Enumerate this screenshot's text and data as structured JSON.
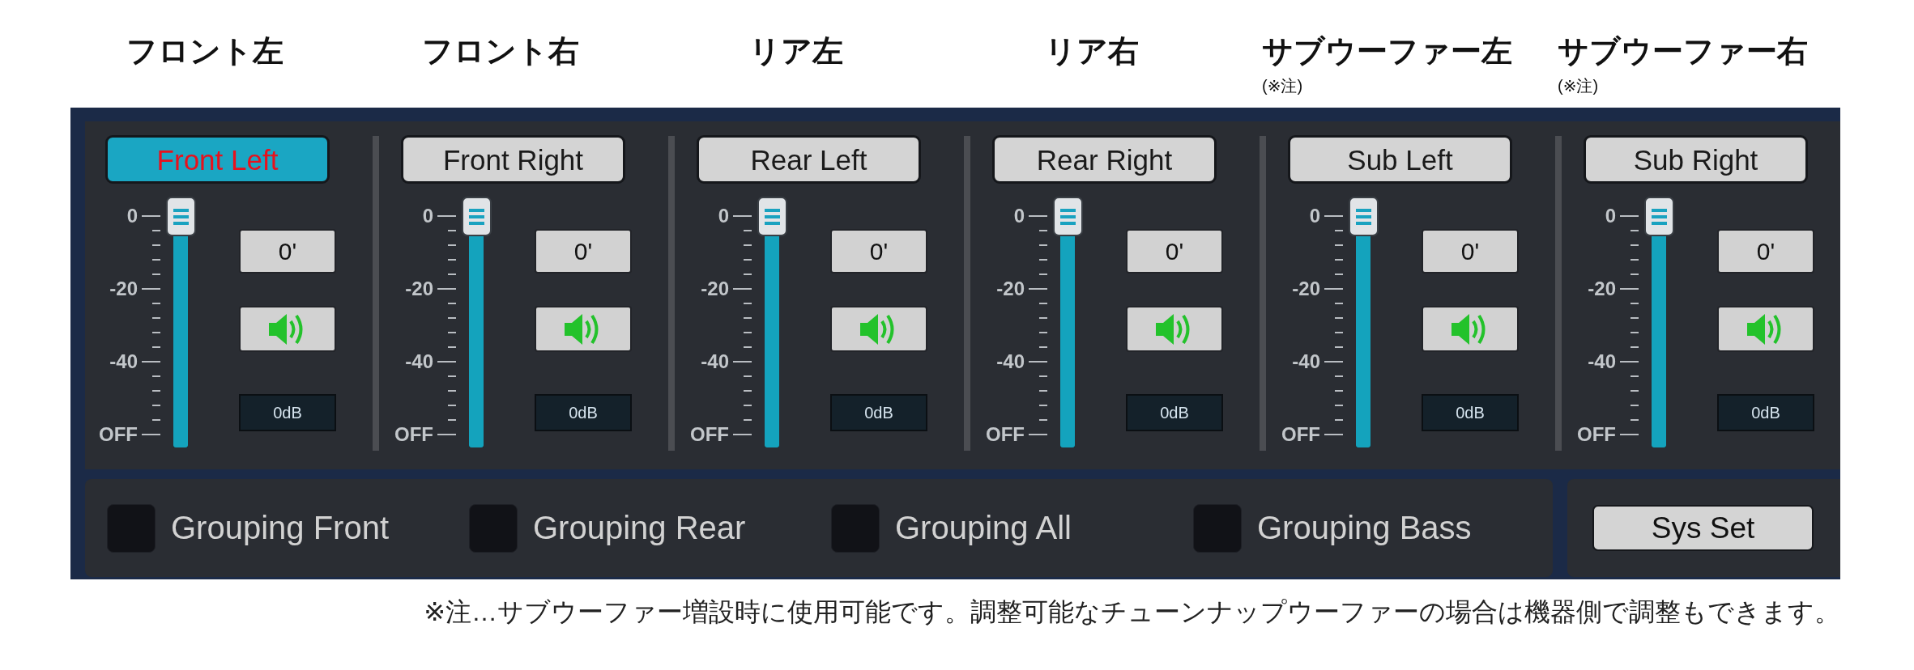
{
  "channel_headers": [
    {
      "label": "フロント左"
    },
    {
      "label": "フロント右"
    },
    {
      "label": "リア左"
    },
    {
      "label": "リア右"
    },
    {
      "label": "サブウーファー左",
      "note": "(※注)"
    },
    {
      "label": "サブウーファー右",
      "note": "(※注)"
    }
  ],
  "channels": [
    {
      "name": "Front Left",
      "selected": true,
      "scale": [
        "0",
        "-20",
        "-40",
        "OFF"
      ],
      "level": 1,
      "value": "0'",
      "muted": false,
      "gain": "0dB"
    },
    {
      "name": "Front Right",
      "selected": false,
      "scale": [
        "0",
        "-20",
        "-40",
        "OFF"
      ],
      "level": 1,
      "value": "0'",
      "muted": false,
      "gain": "0dB"
    },
    {
      "name": "Rear Left",
      "selected": false,
      "scale": [
        "0",
        "-20",
        "-40",
        "OFF"
      ],
      "level": 1,
      "value": "0'",
      "muted": false,
      "gain": "0dB"
    },
    {
      "name": "Rear Right",
      "selected": false,
      "scale": [
        "0",
        "-20",
        "-40",
        "OFF"
      ],
      "level": 1,
      "value": "0'",
      "muted": false,
      "gain": "0dB"
    },
    {
      "name": "Sub Left",
      "selected": false,
      "scale": [
        "0",
        "-20",
        "-40",
        "OFF"
      ],
      "level": 1,
      "value": "0'",
      "muted": false,
      "gain": "0dB"
    },
    {
      "name": "Sub Right",
      "selected": false,
      "scale": [
        "0",
        "-20",
        "-40",
        "OFF"
      ],
      "level": 1,
      "value": "0'",
      "muted": false,
      "gain": "0dB"
    }
  ],
  "grouping": [
    {
      "label": "Grouping Front",
      "checked": false
    },
    {
      "label": "Grouping Rear",
      "checked": false
    },
    {
      "label": "Grouping All",
      "checked": false
    },
    {
      "label": "Grouping Bass",
      "checked": false
    }
  ],
  "sys_button": {
    "label": "Sys Set"
  },
  "footnote": "※注…サブウーファー増設時に使用可能です。調整可能なチューンナップウーファーの場合は機器側で調整もできます。"
}
